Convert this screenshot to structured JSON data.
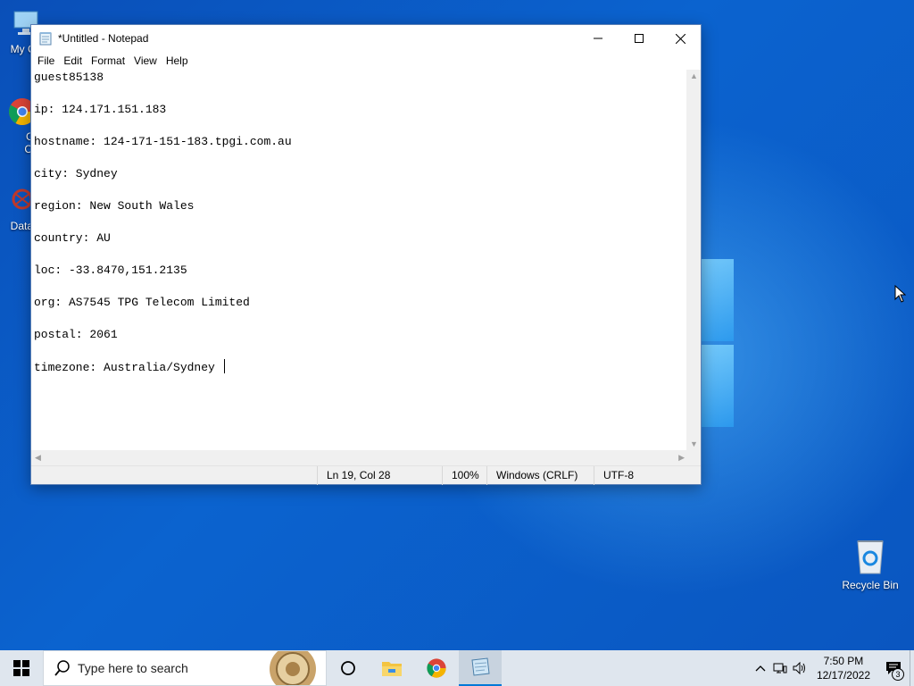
{
  "desktop": {
    "icons": [
      {
        "name": "my-computer",
        "label": "My Co"
      },
      {
        "name": "google-chrome",
        "label": "Go Chr"
      },
      {
        "name": "datawrapper",
        "label": "DataW"
      },
      {
        "name": "recycle-bin",
        "label": "Recycle Bin"
      }
    ]
  },
  "notepad": {
    "title": "*Untitled - Notepad",
    "menu": [
      "File",
      "Edit",
      "Format",
      "View",
      "Help"
    ],
    "content": "guest85138\n\nip: 124.171.151.183\n\nhostname: 124-171-151-183.tpgi.com.au\n\ncity: Sydney\n\nregion: New South Wales\n\ncountry: AU\n\nloc: -33.8470,151.2135\n\norg: AS7545 TPG Telecom Limited\n\npostal: 2061\n\ntimezone: Australia/Sydney ",
    "status": {
      "position": "Ln 19, Col 28",
      "zoom": "100%",
      "line_ending": "Windows (CRLF)",
      "encoding": "UTF-8"
    }
  },
  "taskbar": {
    "search_placeholder": "Type here to search",
    "time": "7:50 PM",
    "date": "12/17/2022",
    "notification_count": "3",
    "pinned": [
      "task-view",
      "file-explorer",
      "chrome",
      "notepad"
    ]
  },
  "colors": {
    "accent": "#0078d7",
    "desktop_bg": "#0a5fc9",
    "taskbar_bg": "#dfe6ee"
  }
}
